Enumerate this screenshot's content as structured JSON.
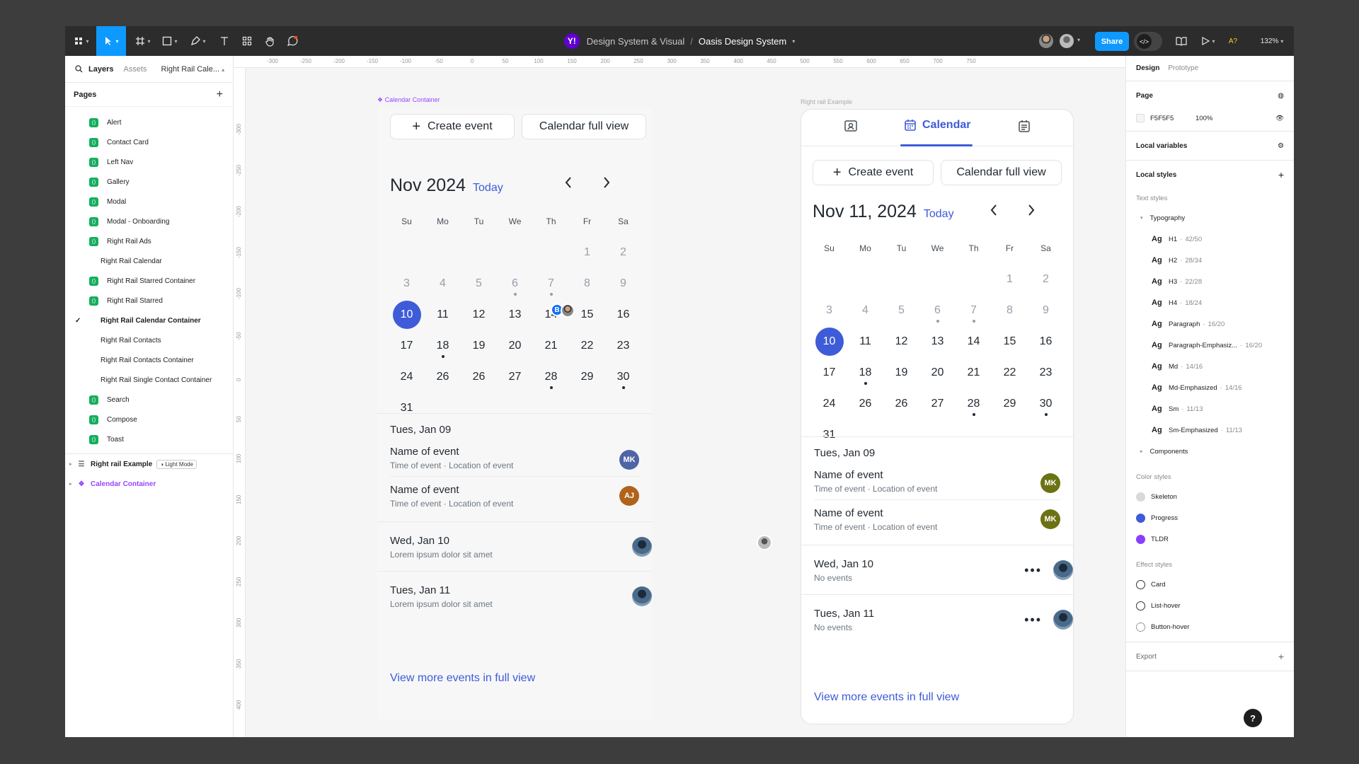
{
  "toolbar": {
    "project": "Design System & Visual",
    "separator": "/",
    "file": "Oasis Design System",
    "share": "Share",
    "zoom": "132%",
    "a11y": "A?",
    "brand_letter": "Y!"
  },
  "left_panel": {
    "tabs": [
      "Layers",
      "Assets"
    ],
    "page_selector": "Right Rail Cale...",
    "pages_title": "Pages",
    "pages": [
      {
        "label": "Alert",
        "icon": true
      },
      {
        "label": "Contact Card",
        "icon": true
      },
      {
        "label": "Left Nav",
        "icon": true
      },
      {
        "label": "Gallery",
        "icon": true
      },
      {
        "label": "Modal",
        "icon": true
      },
      {
        "label": "Modal - Onboarding",
        "icon": true
      },
      {
        "label": "Right Rail Ads",
        "icon": true
      },
      {
        "label": "Right Rail Calendar",
        "icon": false
      },
      {
        "label": "Right Rail Starred Container",
        "icon": true
      },
      {
        "label": "Right Rail Starred",
        "icon": true
      },
      {
        "label": "Right Rail Calendar Container",
        "icon": false,
        "current": true
      },
      {
        "label": "Right Rail Contacts",
        "icon": false
      },
      {
        "label": "Right Rail Contacts Container",
        "icon": false
      },
      {
        "label": "Right Rail Single Contact Container",
        "icon": false
      },
      {
        "label": "Search",
        "icon": true
      },
      {
        "label": "Compose",
        "icon": true
      },
      {
        "label": "Toast",
        "icon": true
      }
    ],
    "layers": [
      {
        "label": "Right rail Example",
        "badge": "Light Mode"
      },
      {
        "label": "Calendar Container"
      }
    ]
  },
  "canvas": {
    "ruler_top": [
      "-300",
      "-250",
      "-200",
      "-150",
      "-100",
      "-50",
      "0",
      "50",
      "100",
      "150",
      "200",
      "250",
      "300",
      "350",
      "400",
      "450",
      "500",
      "550",
      "600",
      "650",
      "700",
      "750"
    ],
    "ruler_left": [
      "-300",
      "-250",
      "-200",
      "-150",
      "-100",
      "-50",
      "0",
      "50",
      "100",
      "150",
      "200",
      "250",
      "300",
      "350",
      "400",
      "450"
    ],
    "frame1_label": "Calendar Container",
    "frame2_label": "Right rail Example"
  },
  "calendar1": {
    "create": "Create event",
    "full_view": "Calendar full view",
    "month": "Nov 2024",
    "today": "Today",
    "weekdays": [
      "Su",
      "Mo",
      "Tu",
      "We",
      "Th",
      "Fr",
      "Sa"
    ],
    "sections": [
      {
        "date": "Tues, Jan 09",
        "events": [
          {
            "name": "Name of event",
            "time": "Time of event",
            "location": "Location of event",
            "initials": "MK",
            "color": "#4f64a7"
          },
          {
            "name": "Name of event",
            "time": "Time of event",
            "location": "Location of event",
            "initials": "AJ",
            "color": "#b0631b"
          }
        ]
      },
      {
        "date": "Wed, Jan 10",
        "desc": "Lorem ipsum dolor sit amet"
      },
      {
        "date": "Tues, Jan 11",
        "desc": "Lorem ipsum dolor sit amet"
      }
    ],
    "view_more": "View more events in full view"
  },
  "calendar2": {
    "tab_label": "Calendar",
    "create": "Create event",
    "full_view": "Calendar full view",
    "month": "Nov 11, 2024",
    "today": "Today",
    "weekdays": [
      "Su",
      "Mo",
      "Tu",
      "We",
      "Th",
      "Fr",
      "Sa"
    ],
    "sections": [
      {
        "date": "Tues, Jan 09",
        "events": [
          {
            "name": "Name of event",
            "time": "Time of event",
            "location": "Location of event",
            "initials": "MK",
            "color": "#6b7213"
          },
          {
            "name": "Name of event",
            "time": "Time of event",
            "location": "Location of event",
            "initials": "MK",
            "color": "#6b7213"
          }
        ]
      },
      {
        "date": "Wed, Jan 10",
        "desc": "No events"
      },
      {
        "date": "Tues, Jan 11",
        "desc": "No events"
      }
    ],
    "view_more": "View more events in full view"
  },
  "days": [
    {
      "n": "1",
      "muted": true
    },
    {
      "n": "2",
      "muted": true
    },
    {
      "n": "3",
      "muted": true
    },
    {
      "n": "4",
      "muted": true
    },
    {
      "n": "5",
      "muted": true
    },
    {
      "n": "6",
      "muted": true,
      "dot": true
    },
    {
      "n": "7",
      "muted": true,
      "dot": true
    },
    {
      "n": "8",
      "muted": true
    },
    {
      "n": "9",
      "muted": true
    },
    {
      "n": "10",
      "sel": true
    },
    {
      "n": "11"
    },
    {
      "n": "12"
    },
    {
      "n": "13"
    },
    {
      "n": "14"
    },
    {
      "n": "15"
    },
    {
      "n": "16"
    },
    {
      "n": "17"
    },
    {
      "n": "18",
      "dot": true
    },
    {
      "n": "19"
    },
    {
      "n": "20"
    },
    {
      "n": "21"
    },
    {
      "n": "22"
    },
    {
      "n": "23"
    },
    {
      "n": "24"
    },
    {
      "n": "26"
    },
    {
      "n": "26"
    },
    {
      "n": "27"
    },
    {
      "n": "28",
      "dot": true
    },
    {
      "n": "29"
    },
    {
      "n": "30",
      "dot": true
    },
    {
      "n": "31"
    }
  ],
  "cursor_initial": "B",
  "right_panel": {
    "tabs": [
      "Design",
      "Prototype"
    ],
    "page_title": "Page",
    "page_color": "F5F5F5",
    "page_opacity": "100%",
    "local_variables": "Local variables",
    "local_styles": "Local styles",
    "text_styles": "Text styles",
    "typography_group": "Typography",
    "typography": [
      {
        "name": "H1",
        "val": "42/50"
      },
      {
        "name": "H2",
        "val": "28/34"
      },
      {
        "name": "H3",
        "val": "22/28"
      },
      {
        "name": "H4",
        "val": "18/24"
      },
      {
        "name": "Paragraph",
        "val": "16/20"
      },
      {
        "name": "Paragraph-Emphasiz...",
        "val": "16/20"
      },
      {
        "name": "Md",
        "val": "14/16"
      },
      {
        "name": "Md-Emphasized",
        "val": "14/16"
      },
      {
        "name": "Sm",
        "val": "11/13"
      },
      {
        "name": "Sm-Emphasized",
        "val": "11/13"
      }
    ],
    "ag": "Ag",
    "components_group": "Components",
    "color_styles": "Color styles",
    "colors": [
      {
        "name": "Skeleton",
        "color": "#d9d9d9"
      },
      {
        "name": "Progress",
        "color": "#3e5bd8"
      },
      {
        "name": "TLDR",
        "color": "#8a3ffc"
      }
    ],
    "effect_styles": "Effect styles",
    "effects": [
      "Card",
      "List-hover",
      "Button-hover"
    ],
    "export": "Export",
    "help": "?"
  }
}
